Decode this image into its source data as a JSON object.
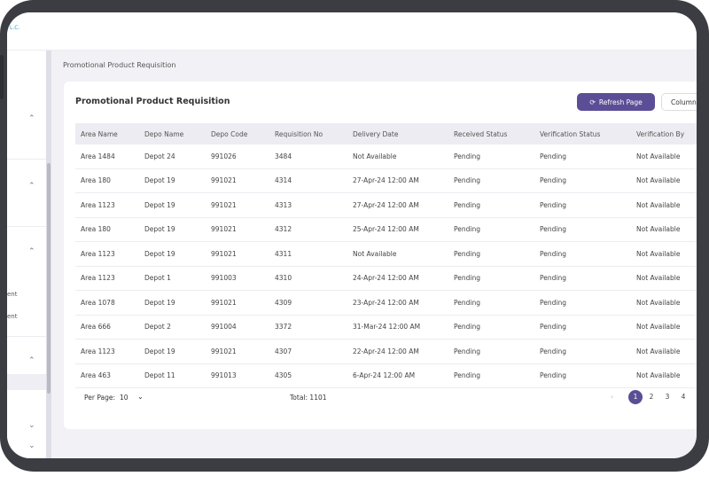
{
  "topbar": {
    "brand_text": "L.C."
  },
  "breadcrumb": "Promotional Product Requisition",
  "card": {
    "title": "Promotional Product Requisition",
    "refresh_label": "Refresh Page",
    "columns_label": "Columns"
  },
  "sidebar": {
    "chevrons": [
      "^",
      "^",
      "^",
      "^",
      "v",
      "v"
    ],
    "partial_texts": [
      "ent",
      "ent"
    ]
  },
  "table": {
    "columns": [
      "Area Name",
      "Depo Name",
      "Depo Code",
      "Requisition No",
      "Delivery Date",
      "Received Status",
      "Verification Status",
      "Verification By"
    ],
    "rows": [
      [
        "Area 1484",
        "Depot 24",
        "991026",
        "3484",
        "Not Available",
        "Pending",
        "Pending",
        "Not Available"
      ],
      [
        "Area 180",
        "Depot 19",
        "991021",
        "4314",
        "27-Apr-24 12:00 AM",
        "Pending",
        "Pending",
        "Not Available"
      ],
      [
        "Area 1123",
        "Depot 19",
        "991021",
        "4313",
        "27-Apr-24 12:00 AM",
        "Pending",
        "Pending",
        "Not Available"
      ],
      [
        "Area 180",
        "Depot 19",
        "991021",
        "4312",
        "25-Apr-24 12:00 AM",
        "Pending",
        "Pending",
        "Not Available"
      ],
      [
        "Area 1123",
        "Depot 19",
        "991021",
        "4311",
        "Not Available",
        "Pending",
        "Pending",
        "Not Available"
      ],
      [
        "Area 1123",
        "Depot 1",
        "991003",
        "4310",
        "24-Apr-24 12:00 AM",
        "Pending",
        "Pending",
        "Not Available"
      ],
      [
        "Area 1078",
        "Depot 19",
        "991021",
        "4309",
        "23-Apr-24 12:00 AM",
        "Pending",
        "Pending",
        "Not Available"
      ],
      [
        "Area 666",
        "Depot 2",
        "991004",
        "3372",
        "31-Mar-24 12:00 AM",
        "Pending",
        "Pending",
        "Not Available"
      ],
      [
        "Area 1123",
        "Depot 19",
        "991021",
        "4307",
        "22-Apr-24 12:00 AM",
        "Pending",
        "Pending",
        "Not Available"
      ],
      [
        "Area 463",
        "Depot 11",
        "991013",
        "4305",
        "6-Apr-24 12:00 AM",
        "Pending",
        "Pending",
        "Not Available"
      ]
    ]
  },
  "footer": {
    "per_page_label": "Per Page:",
    "per_page_value": "10",
    "total": "Total: 1101",
    "pages": [
      "1",
      "2",
      "3",
      "4"
    ],
    "active_page": "1"
  },
  "colors": {
    "accent": "#5b4e96",
    "header_bg": "#ececf2",
    "screen_bg": "#f2f2f6"
  }
}
